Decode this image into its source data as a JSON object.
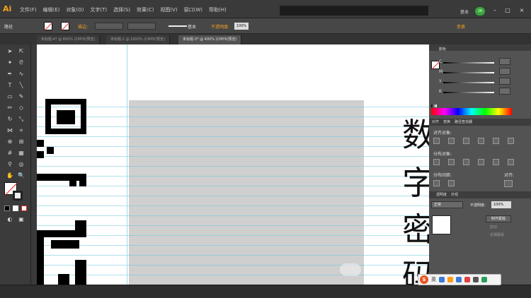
{
  "app": {
    "logo": "Ai"
  },
  "menu": {
    "items": [
      "文件(F)",
      "编辑(E)",
      "对象(O)",
      "文字(T)",
      "选择(S)",
      "效果(C)",
      "视图(V)",
      "窗口(W)",
      "帮助(H)"
    ]
  },
  "window": {
    "workspace_label": "基本",
    "user_badge": "26",
    "minimize": "–",
    "maximize": "□",
    "close": "×"
  },
  "control_bar": {
    "path_label": "路径",
    "stroke_label": "描边:",
    "stroke_style": "基本",
    "opacity_label": "不透明度:",
    "opacity_value": "100%",
    "right_button": "变换"
  },
  "tabs": [
    {
      "label": "未标题-4* @ 800% (CMYK/预览)",
      "active": false
    },
    {
      "label": "未标题-1 @ 1600% (CMYK/预览)",
      "active": false
    },
    {
      "label": "未标题-3* @ 400% (CMYK/预览)",
      "active": true
    }
  ],
  "canvas": {
    "vertical_text": [
      "数",
      "字",
      "密",
      "码"
    ]
  },
  "color_panel": {
    "tab_label": "颜色",
    "channels": [
      "C",
      "M",
      "Y",
      "K"
    ]
  },
  "align_panel": {
    "tabs": [
      "对齐",
      "变换",
      "路径查找器"
    ],
    "align_objects_label": "对齐对象:",
    "distribute_objects_label": "分布对象:",
    "distribute_spacing_label": "分布间距:",
    "align_to_label": "对齐:"
  },
  "transparency_panel": {
    "tabs": [
      "透明度",
      "外观"
    ],
    "blend_mode": "正常",
    "opacity_label": "不透明度:",
    "opacity_value": "100%",
    "make_mask_button": "制作蒙版",
    "clip_label": "剪切",
    "invert_mask_label": "反相蒙版"
  },
  "ime_bar": {
    "logo": "S",
    "lang": "英"
  },
  "colors": {
    "accent_orange": "#f0a020",
    "guide_cyan": "#9fd8e6",
    "artboard_gray": "#cfcfcf",
    "ime_orange": "#e8541e"
  }
}
